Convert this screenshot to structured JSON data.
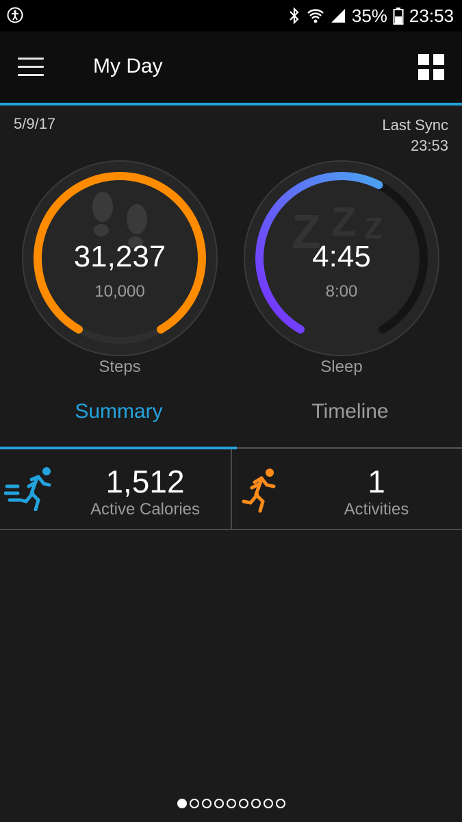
{
  "status_bar": {
    "battery_percent": "35%",
    "time": "23:53",
    "icons": [
      "accessibility-icon",
      "bluetooth-icon",
      "wifi-icon",
      "signal-icon",
      "battery-icon"
    ]
  },
  "app_bar": {
    "title": "My Day",
    "icons": [
      "menu-icon",
      "grid-icon"
    ]
  },
  "summary": {
    "date": "5/9/17",
    "last_sync_label": "Last Sync",
    "last_sync_time": "23:53"
  },
  "rings": {
    "steps": {
      "value": "31,237",
      "goal": "10,000",
      "label": "Steps",
      "progress": 1.0,
      "color": "#ff8c00"
    },
    "sleep": {
      "value": "4:45",
      "goal": "8:00",
      "label": "Sleep",
      "progress": 0.59,
      "color_start": "#7a2cff",
      "color_end": "#4aa3f0"
    }
  },
  "tabs": [
    {
      "label": "Summary",
      "active": true
    },
    {
      "label": "Timeline",
      "active": false
    }
  ],
  "stats": {
    "calories": {
      "value": "1,512",
      "label": "Active Calories",
      "icon": "running-fast-icon",
      "color": "#23a3dd"
    },
    "activities": {
      "value": "1",
      "label": "Activities",
      "icon": "running-icon",
      "color": "#ff8c1a"
    }
  },
  "pager": {
    "count": 9,
    "active_index": 0
  },
  "colors": {
    "accent": "#23a3dd",
    "background": "#1b1b1b"
  }
}
